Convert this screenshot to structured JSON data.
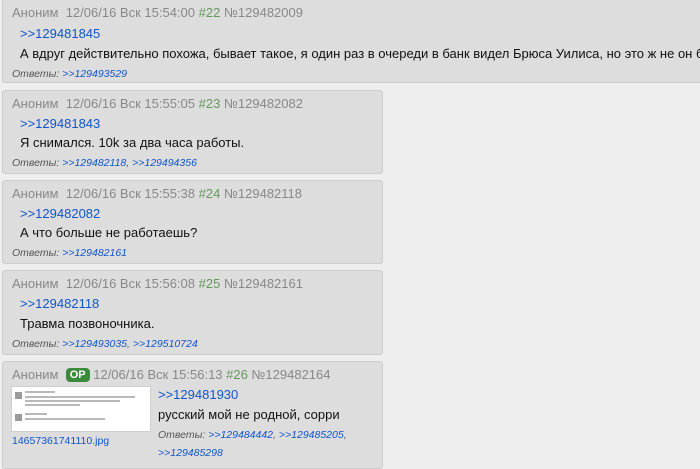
{
  "posts": [
    {
      "author": "Аноним",
      "datetime": "12/06/16 Вск 15:54:00",
      "index": "#22",
      "id": "№129482009",
      "reflink": ">>129481845",
      "text": "А вдруг действительно похожа, бывает такое, я один раз в очереди в банк видел Брюса Уилиса, но это ж не он бы",
      "replies_label": "Ответы:",
      "replies": [
        ">>129493529"
      ]
    },
    {
      "author": "Аноним",
      "datetime": "12/06/16 Вск 15:55:05",
      "index": "#23",
      "id": "№129482082",
      "reflink": ">>129481843",
      "text": "Я снимался. 10k за два часа работы.",
      "replies_label": "Ответы:",
      "replies": [
        ">>129482118",
        ">>129494356"
      ]
    },
    {
      "author": "Аноним",
      "datetime": "12/06/16 Вск 15:55:38",
      "index": "#24",
      "id": "№129482118",
      "reflink": ">>129482082",
      "text": "А что больше не работаешь?",
      "replies_label": "Ответы:",
      "replies": [
        ">>129482161"
      ]
    },
    {
      "author": "Аноним",
      "datetime": "12/06/16 Вск 15:56:08",
      "index": "#25",
      "id": "№129482161",
      "reflink": ">>129482118",
      "text": "Травма позвоночника.",
      "replies_label": "Ответы:",
      "replies": [
        ">>129493035",
        ">>129510724"
      ]
    },
    {
      "author": "Аноним",
      "op_badge": "OP",
      "datetime": "12/06/16 Вск 15:56:13",
      "index": "#26",
      "id": "№129482164",
      "reflink": ">>129481930",
      "text": "русский мой не родной, сорри",
      "replies_label": "Ответы:",
      "replies": [
        ">>129484442",
        ">>129485205",
        ">>129485298"
      ],
      "attachment_name": "14657361741110.jpg"
    }
  ],
  "colors": {
    "page_bg": "#eeeeee",
    "post_bg": "#dddddd",
    "post_number": "#64995b",
    "link": "#1155cc",
    "op_badge_bg": "#3c8a3c"
  }
}
